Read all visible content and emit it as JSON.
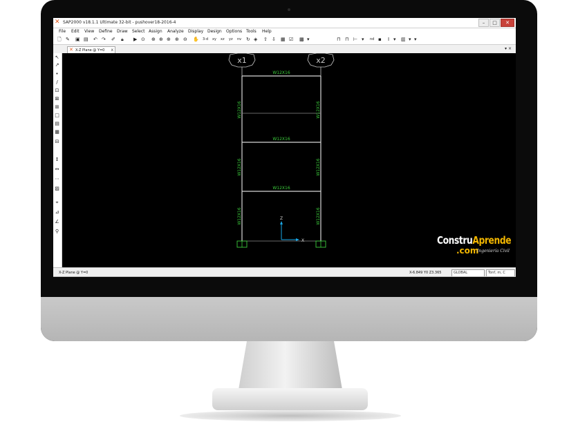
{
  "window": {
    "title": "SAP2000 v18.1.1 Ultimate 32-bit - pushover18-2016-4",
    "controls": [
      "–",
      "□",
      "✕"
    ]
  },
  "menu": [
    "File",
    "Edit",
    "View",
    "Define",
    "Draw",
    "Select",
    "Assign",
    "Analyze",
    "Display",
    "Design",
    "Options",
    "Tools",
    "Help"
  ],
  "toolbar": {
    "view_3d": "3-d",
    "view_xy": "xy",
    "view_xz": "xz",
    "view_yz": "yz",
    "view_nv": "nv",
    "view_nd": "nd",
    "icons": [
      "new-icon",
      "open-icon",
      "save-icon",
      "undo-icon",
      "redo-icon",
      "refresh-icon",
      "lock-icon",
      "run-icon",
      "zoom-icon",
      "pan-icon",
      "move-up-icon",
      "move-down-icon",
      "grid-icon",
      "frame-icon"
    ]
  },
  "tab": {
    "label": "X-Z Plane @ Y=0",
    "close": "x",
    "controls": "▾ ×"
  },
  "left_tools": [
    "↖",
    "↗",
    "•",
    "/",
    "⊡",
    "⊠",
    "⊞",
    "□",
    "▤",
    "▦",
    "⊟",
    "↕",
    "↔",
    "⋯",
    "▨",
    "⌖",
    "⊿",
    "∠",
    "⚲"
  ],
  "drawing": {
    "grid_labels": [
      "x1",
      "x2"
    ],
    "beam_sections": [
      "W12X16",
      "W12X16",
      "W12X16"
    ],
    "column_sections": [
      "W12X16",
      "W12X16",
      "W12X16",
      "W12X16",
      "W12X16",
      "W12X16"
    ],
    "axis_z": "Z",
    "axis_x": "X",
    "line_color": "#d8d8d8",
    "text_color": "#3ccd3c",
    "axis_color": "#19a9e8"
  },
  "status": {
    "plane": "X-Z Plane @ Y=0",
    "coords": "X-6.849  Y0  Z3.365",
    "coord_system": "GLOBAL",
    "units": "Tonf, m, C"
  },
  "watermark": {
    "line1_a": "Constru",
    "line1_b": "Aprende",
    "line2": ".com",
    "sub": "Ingeniería Civil"
  }
}
